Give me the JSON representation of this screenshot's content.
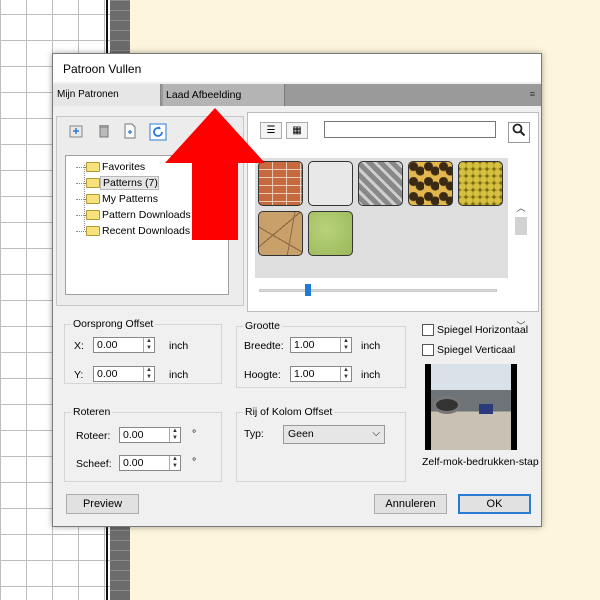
{
  "dialog": {
    "title": "Patroon Vullen",
    "tabs": [
      "Mijn Patronen",
      "Laad Afbeelding"
    ],
    "tab_menu_icon": "≡"
  },
  "toolbar": {
    "icons": [
      "import-icon",
      "trash-icon",
      "new-file-icon",
      "refresh-icon"
    ]
  },
  "tree": {
    "items": [
      {
        "label": "Favorites",
        "selected": false
      },
      {
        "label": "Patterns (7)",
        "selected": true
      },
      {
        "label": "My Patterns",
        "selected": false
      },
      {
        "label": "Pattern Downloads",
        "selected": false
      },
      {
        "label": "Recent Downloads",
        "selected": false
      }
    ]
  },
  "patterns": {
    "search_value": "",
    "items": [
      "brick",
      "blank",
      "diamond-plate",
      "leopard",
      "hex-mesh",
      "stone",
      "green"
    ],
    "zoom_level": 0.2
  },
  "offset": {
    "title": "Oorsprong Offset",
    "x_label": "X:",
    "x_value": "0.00",
    "x_unit": "inch",
    "y_label": "Y:",
    "y_value": "0.00",
    "y_unit": "inch"
  },
  "size": {
    "title": "Grootte",
    "width_label": "Breedte:",
    "width_value": "1.00",
    "width_unit": "inch",
    "height_label": "Hoogte:",
    "height_value": "1.00",
    "height_unit": "inch"
  },
  "rotate": {
    "title": "Roteren",
    "rotate_label": "Roteer:",
    "rotate_value": "0.00",
    "rotate_unit": "°",
    "skew_label": "Scheef:",
    "skew_value": "0.00",
    "skew_unit": "°"
  },
  "rowcol": {
    "title": "Rij of Kolom Offset",
    "type_label": "Typ:",
    "type_value": "Geen"
  },
  "mirror": {
    "horizontal": "Spiegel Horizontaal",
    "horizontal_checked": false,
    "vertical": "Spiegel Verticaal",
    "vertical_checked": false
  },
  "preview_caption": "Zelf-mok-bedrukken-stap",
  "buttons": {
    "preview": "Preview",
    "cancel": "Annuleren",
    "ok": "OK"
  },
  "colors": {
    "accent": "#1f7bd1",
    "arrow": "#ff0000"
  }
}
